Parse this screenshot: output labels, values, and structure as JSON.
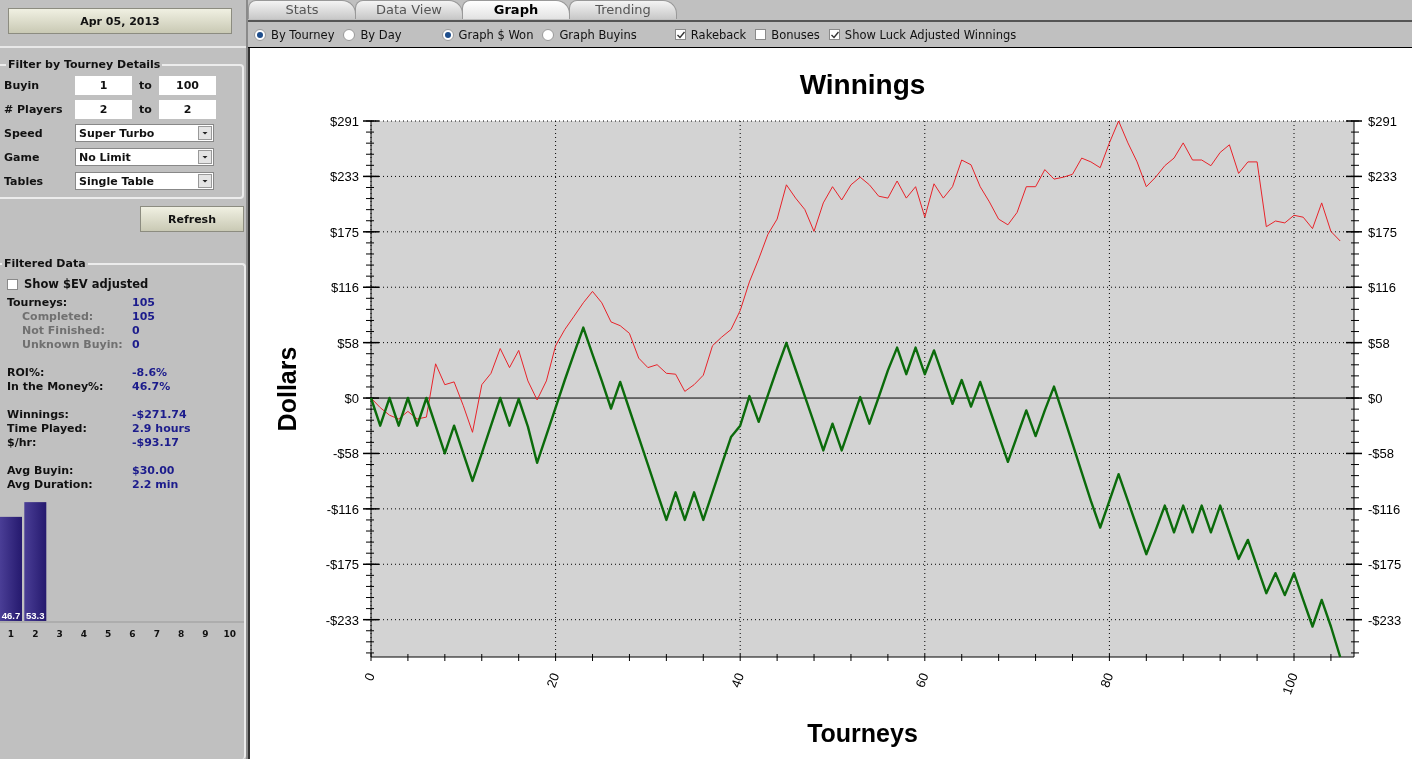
{
  "date_button": "Apr 05, 2013",
  "filter": {
    "title": "Filter by Tourney Details",
    "rows": [
      {
        "kind": "range",
        "label": "Buyin",
        "from": "1",
        "to_label": "to",
        "to": "100"
      },
      {
        "kind": "range",
        "label": "# Players",
        "from": "2",
        "to_label": "to",
        "to": "2"
      },
      {
        "kind": "dropdown",
        "label": "Speed",
        "value": "Super Turbo"
      },
      {
        "kind": "dropdown",
        "label": "Game",
        "value": "No Limit"
      },
      {
        "kind": "dropdown",
        "label": "Tables",
        "value": "Single Table"
      }
    ],
    "refresh_button": "Refresh"
  },
  "filtered": {
    "title": "Filtered Data",
    "ev_checkbox": {
      "label": "Show $EV adjusted",
      "checked": false
    },
    "groups": [
      [
        {
          "label": "Tourneys:",
          "value": "105",
          "sub": false
        },
        {
          "label": "Completed:",
          "value": "105",
          "sub": true
        },
        {
          "label": "Not Finished:",
          "value": "0",
          "sub": true
        },
        {
          "label": "Unknown Buyin:",
          "value": "0",
          "sub": true
        }
      ],
      [
        {
          "label": "ROI%:",
          "value": "-8.6%",
          "sub": false
        },
        {
          "label": "In the Money%:",
          "value": "46.7%",
          "sub": false
        }
      ],
      [
        {
          "label": "Winnings:",
          "value": "-$271.74",
          "sub": false
        },
        {
          "label": "Time Played:",
          "value": "2.9 hours",
          "sub": false
        },
        {
          "label": "$/hr:",
          "value": "-$93.17",
          "sub": false
        }
      ],
      [
        {
          "label": "Avg Buyin:",
          "value": "$30.00",
          "sub": false
        },
        {
          "label": "Avg Duration:",
          "value": "2.2 min",
          "sub": false
        }
      ]
    ],
    "chart_data": {
      "type": "bar",
      "categories": [
        "1",
        "2",
        "3",
        "4",
        "5",
        "6",
        "7",
        "8",
        "9",
        "10"
      ],
      "values": [
        46.7,
        53.3,
        0,
        0,
        0,
        0,
        0,
        0,
        0,
        0
      ],
      "value_labels": [
        "46.7",
        "53.3",
        null,
        null,
        null,
        null,
        null,
        null,
        null,
        null
      ]
    }
  },
  "tabs": [
    {
      "label": "Stats",
      "selected": false
    },
    {
      "label": "Data View",
      "selected": false
    },
    {
      "label": "Graph",
      "selected": true
    },
    {
      "label": "Trending",
      "selected": false
    }
  ],
  "option_groups": [
    [
      {
        "kind": "radio",
        "label": "By Tourney",
        "selected": true
      },
      {
        "kind": "radio",
        "label": "By Day",
        "selected": false
      }
    ],
    [
      {
        "kind": "radio",
        "label": "Graph $ Won",
        "selected": true
      },
      {
        "kind": "radio",
        "label": "Graph Buyins",
        "selected": false
      }
    ],
    [
      {
        "kind": "checkbox",
        "label": "Rakeback",
        "checked": true
      },
      {
        "kind": "checkbox",
        "label": "Bonuses",
        "checked": false
      },
      {
        "kind": "checkbox",
        "label": "Show Luck Adjusted Winnings",
        "checked": true
      }
    ]
  ],
  "graph": {
    "right_yticks": [
      "$291",
      "$233",
      "$175",
      "$116",
      "$58",
      "$0",
      "-$58",
      "-$116",
      "-$175",
      "-$233"
    ],
    "chart_data": {
      "type": "line",
      "title": "Winnings",
      "xlabel": "Tourneys",
      "ylabel": "Dollars",
      "grid": true,
      "x": [
        0,
        1,
        2,
        3,
        4,
        5,
        6,
        7,
        8,
        9,
        10,
        11,
        12,
        13,
        14,
        15,
        16,
        17,
        18,
        19,
        20,
        21,
        22,
        23,
        24,
        25,
        26,
        27,
        28,
        29,
        30,
        31,
        32,
        33,
        34,
        35,
        36,
        37,
        38,
        39,
        40,
        41,
        42,
        43,
        44,
        45,
        46,
        47,
        48,
        49,
        50,
        51,
        52,
        53,
        54,
        55,
        56,
        57,
        58,
        59,
        60,
        61,
        62,
        63,
        64,
        65,
        66,
        67,
        68,
        69,
        70,
        71,
        72,
        73,
        74,
        75,
        76,
        77,
        78,
        79,
        80,
        81,
        82,
        83,
        84,
        85,
        86,
        87,
        88,
        89,
        90,
        91,
        92,
        93,
        94,
        95,
        96,
        97,
        98,
        99,
        100,
        101,
        102,
        103,
        104,
        105
      ],
      "xlim": [
        0,
        106.5
      ],
      "ylim": [
        -272,
        291
      ],
      "xticks": [
        {
          "value": 0,
          "label": "0"
        },
        {
          "value": 20,
          "label": "20"
        },
        {
          "value": 40,
          "label": "40"
        },
        {
          "value": 60,
          "label": "60"
        },
        {
          "value": 80,
          "label": "80"
        },
        {
          "value": 100,
          "label": "100"
        }
      ],
      "yticks": [
        {
          "value": 291,
          "label": "$291"
        },
        {
          "value": 232.8,
          "label": "$233"
        },
        {
          "value": 174.6,
          "label": "$175"
        },
        {
          "value": 116.4,
          "label": "$116"
        },
        {
          "value": 58.2,
          "label": "$58"
        },
        {
          "value": 0,
          "label": "$0"
        },
        {
          "value": -58.2,
          "label": "-$58"
        },
        {
          "value": -116.4,
          "label": "-$116"
        },
        {
          "value": -174.6,
          "label": "-$175"
        },
        {
          "value": -232.8,
          "label": "-$233"
        }
      ],
      "series": [
        {
          "color": "#e8232a",
          "values": [
            0,
            -10,
            -18,
            -22,
            -14,
            -22,
            -20,
            36,
            14,
            17,
            -8,
            -36,
            14,
            26,
            52,
            32,
            50,
            18,
            -2,
            18,
            55,
            72,
            86,
            100,
            112,
            100,
            80,
            76,
            68,
            42,
            32,
            35,
            26,
            25,
            7,
            14,
            24,
            55,
            64,
            72,
            92,
            122,
            146,
            172,
            188,
            224,
            210,
            198,
            175,
            205,
            222,
            208,
            224,
            232,
            224,
            212,
            210,
            228,
            210,
            222,
            190,
            225,
            210,
            222,
            250,
            245,
            222,
            206,
            188,
            182,
            195,
            222,
            222,
            240,
            230,
            232,
            235,
            252,
            248,
            242,
            268,
            291,
            268,
            248,
            222,
            232,
            244,
            252,
            268,
            250,
            250,
            244,
            258,
            266,
            236,
            248,
            248,
            180,
            186,
            184,
            192,
            190,
            178,
            205,
            175,
            165
          ]
        },
        {
          "color": "#0b6b0b",
          "values": [
            0,
            -29,
            0,
            -29,
            0,
            -29,
            0,
            -29,
            -58,
            -29,
            -58,
            -87,
            -58,
            -29,
            0,
            -29,
            -1,
            -30,
            -68,
            -39,
            -10,
            19,
            47,
            74,
            46,
            18,
            -11,
            17,
            -12,
            -41,
            -70,
            -99,
            -128,
            -99,
            -128,
            -99,
            -128,
            -99,
            -70,
            -41,
            -29,
            2,
            -25,
            3,
            31,
            58,
            30,
            2,
            -26,
            -55,
            -27,
            -55,
            -27,
            1,
            -27,
            1,
            29,
            53,
            25,
            53,
            25,
            50,
            22,
            -6,
            19,
            -9,
            17,
            -11,
            -39,
            -67,
            -40,
            -13,
            -40,
            -13,
            12,
            -18,
            -48,
            -78,
            -108,
            -136,
            -108,
            -80,
            -108,
            -136,
            -164,
            -139,
            -113,
            -141,
            -113,
            -141,
            -113,
            -141,
            -113,
            -141,
            -169,
            -149,
            -177,
            -205,
            -184,
            -207,
            -184,
            -212,
            -240,
            -212,
            -240,
            -272
          ]
        }
      ]
    }
  }
}
